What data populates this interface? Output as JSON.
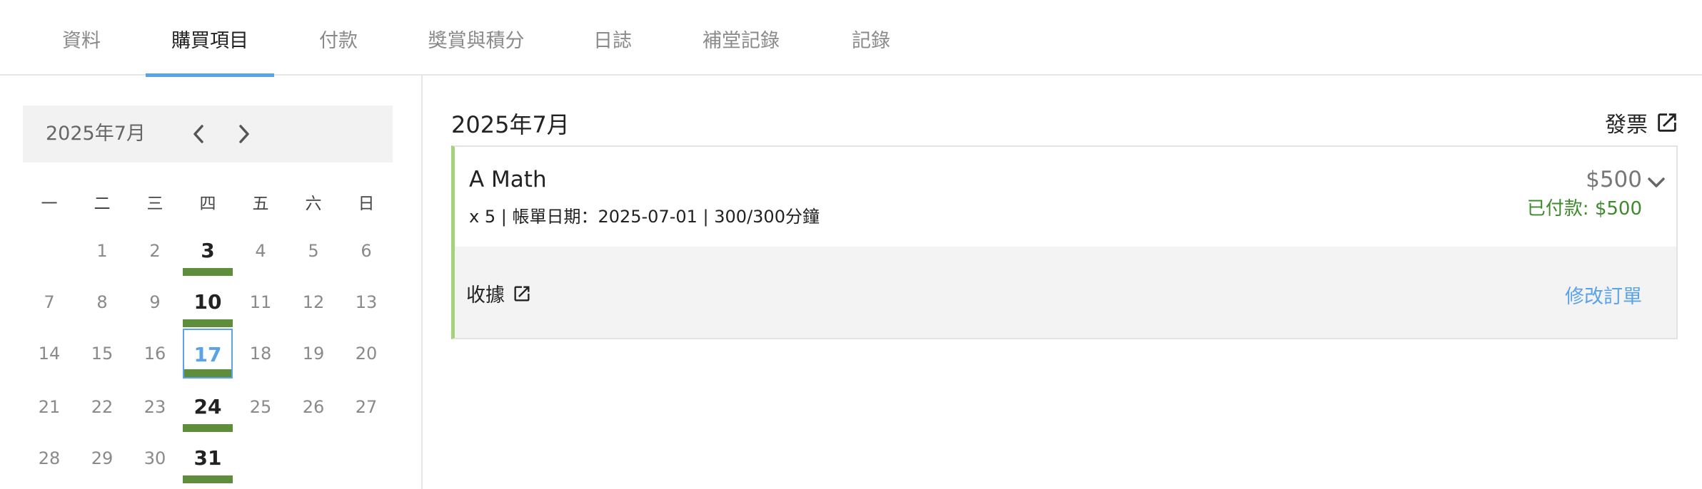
{
  "tabs": [
    {
      "label": "資料"
    },
    {
      "label": "購買項目"
    },
    {
      "label": "付款"
    },
    {
      "label": "獎賞與積分"
    },
    {
      "label": "日誌"
    },
    {
      "label": "補堂記錄"
    },
    {
      "label": "記錄"
    }
  ],
  "active_tab": "購買項目",
  "calendar": {
    "title": "2025年7月",
    "weekdays": [
      "一",
      "二",
      "三",
      "四",
      "五",
      "六",
      "日"
    ],
    "today": 17,
    "purchase_days": [
      3,
      10,
      17,
      24,
      31
    ],
    "highlight_color": "#5e8e3c",
    "today_color": "#5aa3e8"
  },
  "main": {
    "month_title": "2025年7月",
    "invoice_label": "發票",
    "order": {
      "course": "A Math",
      "meta": "x 5 | 帳單日期：2025-07-01 | 300/300分鐘",
      "price": "$500",
      "paid": "已付款: $500",
      "receipt_label": "收據",
      "edit_label": "修改訂單"
    }
  },
  "colors": {
    "accent": "#5aa3e8",
    "paid_green": "#3f8a2e",
    "card_left_border": "#a4d17c"
  },
  "icons": {
    "prev": "chevron-left-icon",
    "next": "chevron-right-icon",
    "external": "open-in-new-icon",
    "expand": "chevron-down-icon"
  }
}
